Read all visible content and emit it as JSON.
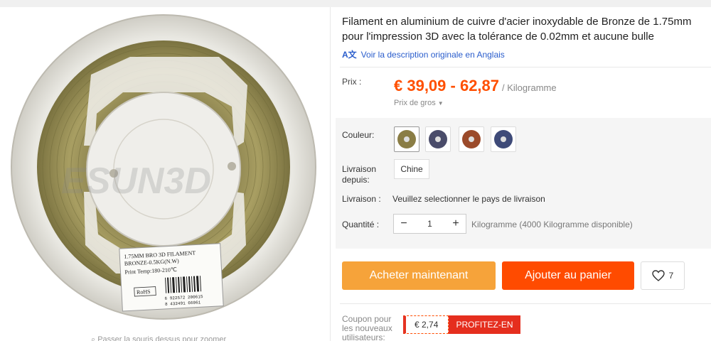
{
  "product": {
    "title": "Filament en aluminium de cuivre d'acier inoxydable de Bronze de 1.75mm pour l'impression 3D avec la tolérance de 0.02mm et aucune bulle",
    "translate_link": "Voir la description originale en Anglais",
    "zoom_hint": "Passer la souris dessus pour zoomer",
    "spool_label": {
      "line1": "1.75MM BRO 3D FILAMENT",
      "line2": "BRONZE-0.5KG(N.W)",
      "line3": "Print Temp:180-210℃",
      "rohs": "RoHS",
      "barcode": "6 922572 200615",
      "barcode2": "8 432491 66061"
    },
    "watermark": "ESUN3D"
  },
  "price": {
    "label": "Prix :",
    "value": "€ 39,09 - 62,87",
    "unit": "/ Kilogramme",
    "wholesale": "Prix de gros"
  },
  "options": {
    "color_label": "Couleur:",
    "ship_from_label": "Livraison depuis:",
    "ship_from_value": "Chine",
    "shipping_label": "Livraison :",
    "shipping_text": "Veuillez selectionner le pays de livraison",
    "quantity_label": "Quantité :",
    "quantity_value": "1",
    "availability": "Kilogramme (4000 Kilogramme disponible)"
  },
  "actions": {
    "buy_now": "Acheter maintenant",
    "add_to_cart": "Ajouter au panier",
    "wishlist_count": "7"
  },
  "coupon": {
    "label": "Coupon pour les nouveaux utilisateurs:",
    "value": "€ 2,74",
    "cta": "PROFITEZ-EN"
  },
  "colors": {
    "accent_orange": "#ff4b00",
    "buy_orange": "#f6a33a",
    "price_orange": "#ff4f00",
    "link_blue": "#2a5dcc"
  }
}
